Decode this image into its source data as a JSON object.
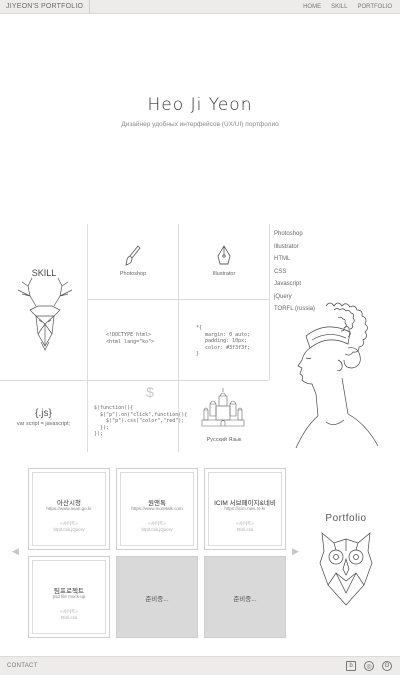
{
  "header": {
    "brand": "JIYEON'S PORTFOLIO",
    "nav": [
      "HOME",
      "SKILL",
      "PORTFOLIO"
    ]
  },
  "hero": {
    "name": "Heo Ji Yeon",
    "subtitle": "Дизайнер удобных интерфейсов (UX/UI) портфолио"
  },
  "skill": {
    "title": "SKILL",
    "photoshop_label": "Photoshop",
    "illustrator_label": "Illustrator",
    "html_code": "<!DOCTYPE html>\n<html lang=\"ko\">",
    "css_code": "*{\n   margin: 0 auto;\n   padding: 10px;\n   color: #3f3f3f;\n}",
    "js_logo": "{.js}",
    "js_caption": "var script = javascript;",
    "jquery_code": "$(function(){\n  $(\"p\").on(\"click\",function(){\n    $(\"p\").css(\"color\",\"red\");\n  });\n});",
    "jquery_logo": "$",
    "russian_label": "Русский Язык",
    "list": [
      "Photoshop",
      "Illustrator",
      "HTML",
      "CSS",
      "Javascript",
      "jQuery",
      "TORFL (russia)"
    ]
  },
  "portfolio": {
    "title": "Portfolio",
    "cards": [
      {
        "title": "아산시청",
        "url": "https://www.asan.go.kr",
        "tag": "<사이트>",
        "tech": "html,css,jQuery"
      },
      {
        "title": "원앤톡",
        "url": "https://www.moretalk.com",
        "tag": "<사이트>",
        "tech": "html,css,jQuery"
      },
      {
        "title": "ICIM 서브페이지&네비",
        "url": "https://icim.nies.re.kr",
        "tag": "<사이트>",
        "tech": "html,css"
      },
      {
        "title": "팀프로젝트",
        "url": "psd file mock-up",
        "tag": "<사이트>",
        "tech": "html,css"
      }
    ],
    "pending_label": "준비중...",
    "prev_arrow": "◀",
    "next_arrow": "▶"
  },
  "footer": {
    "contact": "CONTACT",
    "icons": [
      "blog-icon",
      "instagram-icon",
      "github-icon"
    ]
  },
  "colors": {
    "bar_bg": "#eeecea",
    "grid_line": "#dcdcdc",
    "pending_bg": "#d9d9d9"
  }
}
